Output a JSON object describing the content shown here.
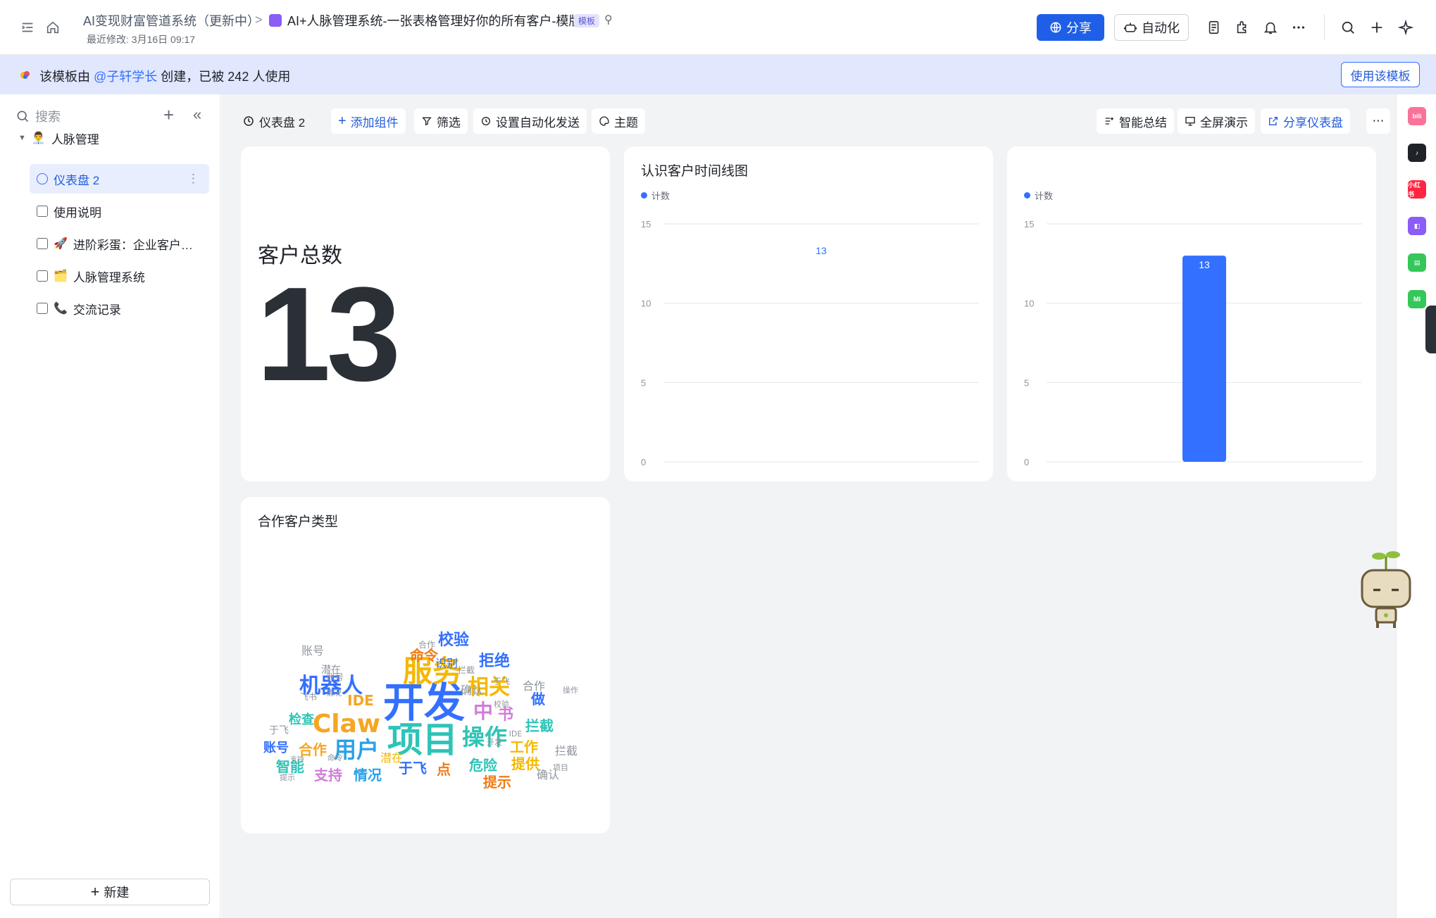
{
  "header": {
    "breadcrumb_parent": "AI变现财富管道系统（更新中）",
    "breadcrumb_sep": ">",
    "doc_title": "AI+人脉管理系统-一张表格管理好你的所有客户-模版",
    "template_badge": "模板",
    "last_modified": "最近修改: 3月16日 09:17",
    "share_label": "分享",
    "automation_label": "自动化"
  },
  "banner": {
    "prefix": "该模板由 ",
    "author": "@子轩学长",
    "suffix": " 创建，已被 242 人使用",
    "use_button": "使用该模板"
  },
  "sidebar": {
    "search_placeholder": "搜索",
    "group_label": "人脉管理",
    "group_emoji": "👨‍💼",
    "items": [
      {
        "label": "仪表盘 2",
        "emoji": ""
      },
      {
        "label": "使用说明",
        "emoji": ""
      },
      {
        "label": "进阶彩蛋：企业客户…",
        "emoji": "🚀"
      },
      {
        "label": "人脉管理系统",
        "emoji": "🗂️"
      },
      {
        "label": "交流记录",
        "emoji": "📞"
      }
    ],
    "new_button": "新建"
  },
  "toolbar": {
    "dashboard_name": "仪表盘 2",
    "add_component": "添加组件",
    "filter": "筛选",
    "auto_send": "设置自动化发送",
    "theme": "主题",
    "ai_summary": "智能总结",
    "fullscreen": "全屏演示",
    "share_dashboard": "分享仪表盘"
  },
  "cards": {
    "total_title": "客户总数",
    "total_value": "13",
    "timeline_title": "认识客户时间线图",
    "timeline_legend": "计数",
    "bar_legend": "计数",
    "wordcloud_title": "合作客户类型"
  },
  "chart_data": [
    {
      "type": "line",
      "title": "认识客户时间线图",
      "series": [
        {
          "name": "计数",
          "values": [
            13
          ]
        }
      ],
      "ylim": [
        0,
        15
      ],
      "yticks": [
        "0",
        "5",
        "10",
        "15"
      ],
      "data_labels": [
        "13"
      ],
      "grid": true,
      "legend": "top-left",
      "color": "#3370ff"
    },
    {
      "type": "bar",
      "series": [
        {
          "name": "计数",
          "values": [
            13
          ]
        }
      ],
      "ylim": [
        0,
        15
      ],
      "yticks": [
        "0",
        "5",
        "10",
        "15"
      ],
      "data_labels": [
        "13"
      ],
      "grid": true,
      "legend": "top-left",
      "color": "#3370ff"
    }
  ],
  "wordcloud": {
    "words": [
      {
        "t": "开发",
        "s": 58,
        "c": "#3370ff"
      },
      {
        "t": "项目",
        "s": 50,
        "c": "#2ec4b6"
      },
      {
        "t": "服务",
        "s": 42,
        "c": "#f5b800"
      },
      {
        "t": "Claw",
        "s": 36,
        "c": "#f5a623"
      },
      {
        "t": "机器人",
        "s": 30,
        "c": "#3370ff"
      },
      {
        "t": "操作",
        "s": 32,
        "c": "#2ec4b6"
      },
      {
        "t": "用户",
        "s": 32,
        "c": "#2aa1e8"
      },
      {
        "t": "相关",
        "s": 30,
        "c": "#f5b800"
      },
      {
        "t": "中",
        "s": 28,
        "c": "#d27cd9"
      },
      {
        "t": "书",
        "s": 22,
        "c": "#d27cd9"
      },
      {
        "t": "拒绝",
        "s": 22,
        "c": "#3370ff"
      },
      {
        "t": "校验",
        "s": 22,
        "c": "#3370ff"
      },
      {
        "t": "命令",
        "s": 20,
        "c": "#f07b16"
      },
      {
        "t": "IDE",
        "s": 20,
        "c": "#f5a623"
      },
      {
        "t": "危险",
        "s": 20,
        "c": "#2ec4b6"
      },
      {
        "t": "提供",
        "s": 20,
        "c": "#f5b800"
      },
      {
        "t": "工作",
        "s": 20,
        "c": "#f5b800"
      },
      {
        "t": "拦截",
        "s": 20,
        "c": "#2ec4b6"
      },
      {
        "t": "智能",
        "s": 20,
        "c": "#2ec4b6"
      },
      {
        "t": "支持",
        "s": 20,
        "c": "#d27cd9"
      },
      {
        "t": "情况",
        "s": 20,
        "c": "#2aa1e8"
      },
      {
        "t": "于飞",
        "s": 20,
        "c": "#3370ff"
      },
      {
        "t": "点",
        "s": 20,
        "c": "#f07b16"
      },
      {
        "t": "提示",
        "s": 20,
        "c": "#f07b16"
      },
      {
        "t": "合作",
        "s": 20,
        "c": "#f5a623"
      },
      {
        "t": "检查",
        "s": 18,
        "c": "#2ec4b6"
      },
      {
        "t": "账号",
        "s": 18,
        "c": "#3370ff"
      },
      {
        "t": "做",
        "s": 20,
        "c": "#3370ff"
      },
      {
        "t": "识别",
        "s": 16,
        "c": "#3370ff"
      },
      {
        "t": "确认",
        "s": 16,
        "c": "#8f959e"
      },
      {
        "t": "潜在",
        "s": 16,
        "c": "#f5b800"
      },
      {
        "t": "合作",
        "s": 16,
        "c": "#8f959e"
      },
      {
        "t": "账号",
        "s": 16,
        "c": "#8f959e"
      },
      {
        "t": "拦截",
        "s": 16,
        "c": "#8f959e"
      },
      {
        "t": "于飞",
        "s": 14,
        "c": "#8f959e"
      },
      {
        "t": "确认",
        "s": 16,
        "c": "#8f959e"
      },
      {
        "t": "潜在",
        "s": 14,
        "c": "#8f959e"
      },
      {
        "t": "飞书",
        "s": 12,
        "c": "#8f959e"
      },
      {
        "t": "情况",
        "s": 11,
        "c": "#8f959e"
      },
      {
        "t": "开发",
        "s": 11,
        "c": "#8f959e"
      },
      {
        "t": "账号",
        "s": 12,
        "c": "#8f959e"
      },
      {
        "t": "项目",
        "s": 11,
        "c": "#8f959e"
      },
      {
        "t": "操作",
        "s": 11,
        "c": "#8f959e"
      },
      {
        "t": "合作",
        "s": 12,
        "c": "#8f959e"
      },
      {
        "t": "命令",
        "s": 11,
        "c": "#8f959e"
      },
      {
        "t": "拦截",
        "s": 12,
        "c": "#8f959e"
      },
      {
        "t": "于飞",
        "s": 12,
        "c": "#8f959e"
      },
      {
        "t": "校验",
        "s": 11,
        "c": "#8f959e"
      },
      {
        "t": "IDE",
        "s": 11,
        "c": "#8f959e"
      },
      {
        "t": "支持",
        "s": 10,
        "c": "#8f959e"
      },
      {
        "t": "提示",
        "s": 11,
        "c": "#8f959e"
      }
    ]
  },
  "right_rail": {
    "apps": [
      {
        "label": "bili",
        "color": "#fb7299"
      },
      {
        "label": "♪",
        "color": "#1f2329"
      },
      {
        "label": "小红书",
        "color": "#ff2442"
      },
      {
        "label": "◧",
        "color": "#8b5cf6"
      },
      {
        "label": "▤",
        "color": "#34c759"
      },
      {
        "label": "MI",
        "color": "#34c759"
      }
    ]
  },
  "colors": {
    "accent": "#3370ff",
    "share_button": "#1f5fe8",
    "banner_bg": "#e1e7fd",
    "main_bg": "#f2f3f5"
  }
}
